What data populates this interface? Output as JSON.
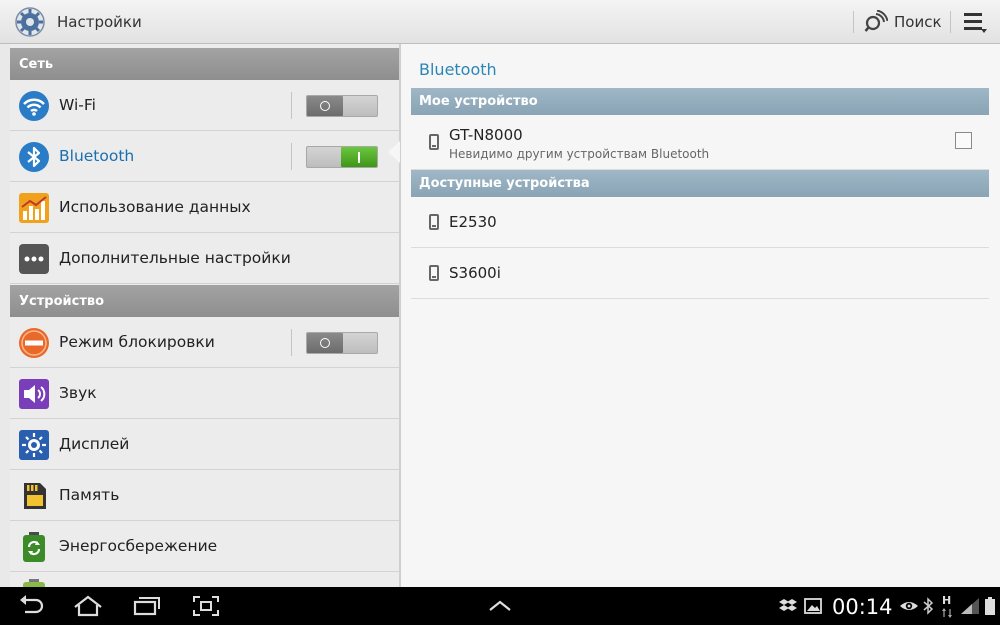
{
  "actionbar": {
    "title": "Настройки",
    "search_label": "Поиск"
  },
  "sidebar": {
    "sections": [
      {
        "label": "Сеть"
      },
      {
        "label": "Устройство"
      }
    ],
    "items": [
      {
        "label": "Wi-Fi",
        "icon": "wifi-icon",
        "toggle": "off"
      },
      {
        "label": "Bluetooth",
        "icon": "bluetooth-icon",
        "toggle": "on",
        "selected": true
      },
      {
        "label": "Использование данных",
        "icon": "data-usage-icon"
      },
      {
        "label": "Дополнительные настройки",
        "icon": "more-settings-icon"
      },
      {
        "label": "Режим блокировки",
        "icon": "blocking-mode-icon",
        "toggle": "off"
      },
      {
        "label": "Звук",
        "icon": "sound-icon"
      },
      {
        "label": "Дисплей",
        "icon": "display-icon"
      },
      {
        "label": "Память",
        "icon": "storage-icon"
      },
      {
        "label": "Энергосбережение",
        "icon": "power-saving-icon"
      }
    ]
  },
  "detail": {
    "title": "Bluetooth",
    "my_device_header": "Мое устройство",
    "my_device": {
      "name": "GT-N8000",
      "status": "Невидимо другим устройствам Bluetooth",
      "visible_checked": false
    },
    "available_header": "Доступные устройства",
    "available_devices": [
      {
        "name": "E2530"
      },
      {
        "name": "S3600i"
      }
    ]
  },
  "statusbar": {
    "time": "00:14",
    "network": "H"
  },
  "colors": {
    "accent": "#2a86b7",
    "toggle_on": "#4fae26",
    "section_left": "#999999",
    "section_right": "#94adbd"
  }
}
